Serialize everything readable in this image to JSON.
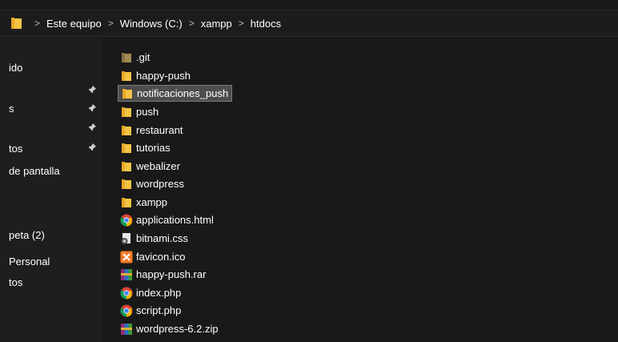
{
  "breadcrumb": [
    "Este equipo",
    "Windows (C:)",
    "xampp",
    "htdocs"
  ],
  "separator": ">",
  "nav": {
    "items": [
      {
        "label": "ido",
        "pinned": false
      },
      {
        "label": "",
        "pinned": true
      },
      {
        "label": "s",
        "pinned": true
      },
      {
        "label": "",
        "pinned": true
      },
      {
        "label": "tos",
        "pinned": true
      },
      {
        "label": "de pantalla",
        "pinned": false
      },
      {
        "label": "peta (2)",
        "pinned": false
      },
      {
        "label": "Personal",
        "pinned": false
      },
      {
        "label": "tos",
        "pinned": false
      }
    ]
  },
  "files": [
    {
      "name": ".git",
      "icon": "folder-icon",
      "selected": false
    },
    {
      "name": "happy-push",
      "icon": "folder-icon",
      "selected": false
    },
    {
      "name": "notificaciones_push",
      "icon": "folder-icon",
      "selected": true
    },
    {
      "name": "push",
      "icon": "folder-icon",
      "selected": false
    },
    {
      "name": "restaurant",
      "icon": "folder-icon",
      "selected": false
    },
    {
      "name": "tutorias",
      "icon": "folder-icon",
      "selected": false
    },
    {
      "name": "webalizer",
      "icon": "folder-icon",
      "selected": false
    },
    {
      "name": "wordpress",
      "icon": "folder-icon",
      "selected": false
    },
    {
      "name": "xampp",
      "icon": "folder-icon",
      "selected": false
    },
    {
      "name": "applications.html",
      "icon": "chrome-icon",
      "selected": false
    },
    {
      "name": "bitnami.css",
      "icon": "css-file-icon",
      "selected": false
    },
    {
      "name": "favicon.ico",
      "icon": "xampp-icon",
      "selected": false
    },
    {
      "name": "happy-push.rar",
      "icon": "winrar-icon",
      "selected": false
    },
    {
      "name": "index.php",
      "icon": "chrome-icon",
      "selected": false
    },
    {
      "name": "script.php",
      "icon": "chrome-icon",
      "selected": false
    },
    {
      "name": "wordpress-6.2.zip",
      "icon": "winrar-icon",
      "selected": false
    }
  ],
  "colors": {
    "folder": "#f3c344",
    "folder_git": "#a38a52",
    "selection": "#4d4d4d",
    "background": "#191919"
  }
}
